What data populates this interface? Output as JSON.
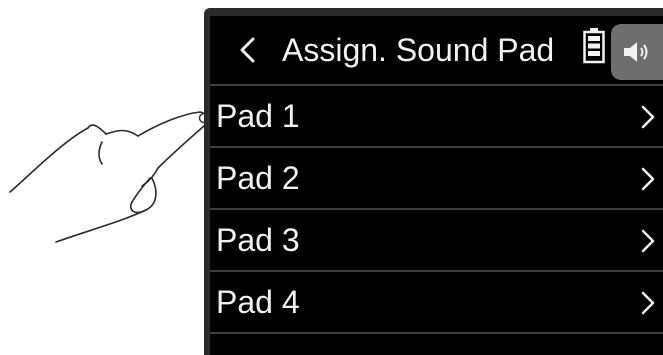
{
  "header": {
    "title": "Assign. Sound Pad",
    "back_icon": "chevron-left-icon",
    "battery_icon": "battery-icon",
    "speaker_icon": "speaker-icon"
  },
  "pads": [
    {
      "label": "Pad 1"
    },
    {
      "label": "Pad 2"
    },
    {
      "label": "Pad 3"
    },
    {
      "label": "Pad 4"
    }
  ],
  "colors": {
    "screen_bg": "#000000",
    "text": "#f2f2f2",
    "divider": "#3c3c3c",
    "speaker_button": "#6e6e6e"
  }
}
